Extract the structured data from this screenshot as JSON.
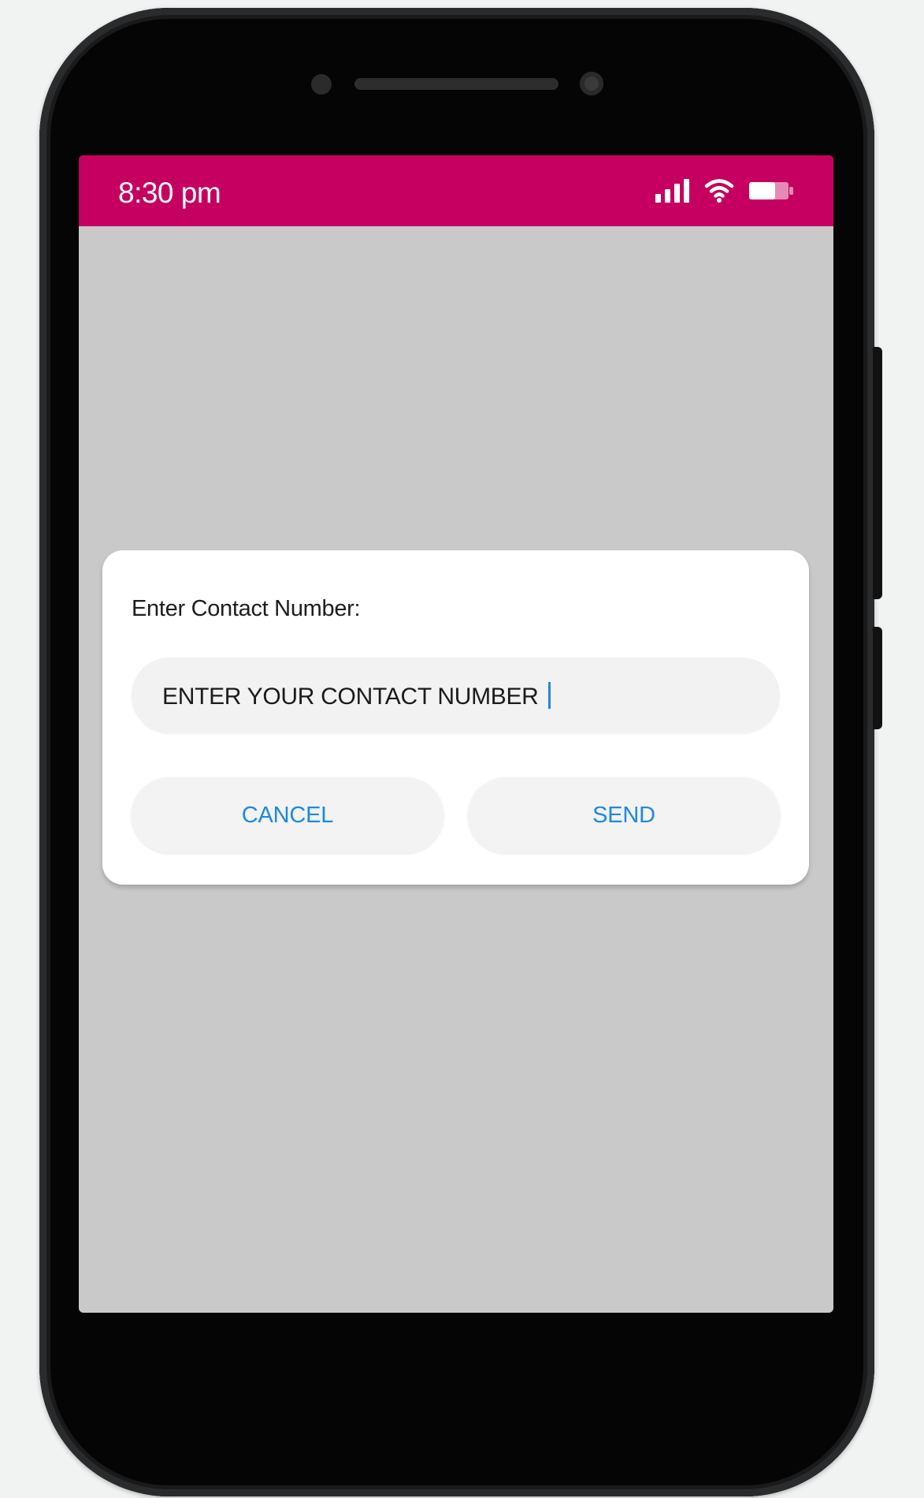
{
  "status_bar": {
    "time": "8:30 pm",
    "icons": [
      "signal-icon",
      "wifi-icon",
      "battery-icon"
    ],
    "color": "#c60060"
  },
  "dialog": {
    "title": "Enter Contact Number:",
    "input": {
      "placeholder": "ENTER YOUR CONTACT NUMBER",
      "value": ""
    },
    "cancel_label": "CANCEL",
    "send_label": "SEND"
  },
  "colors": {
    "accent": "#1e88e5",
    "screen_background": "#c9c9c9",
    "dialog_background": "#ffffff"
  }
}
